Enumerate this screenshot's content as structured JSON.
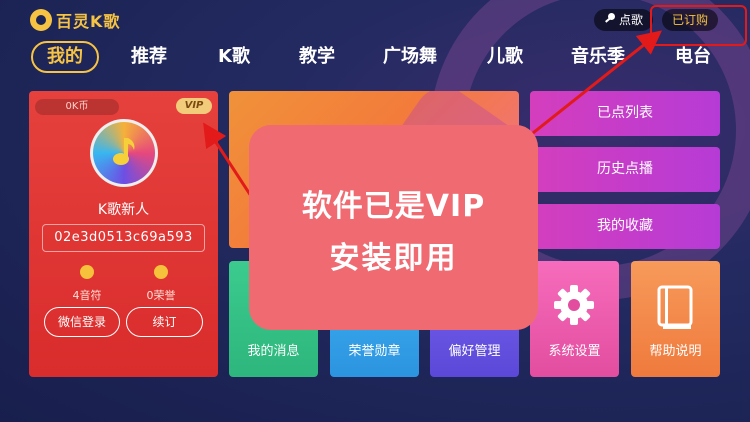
{
  "header": {
    "app_name": "百灵K歌",
    "song_button": "点歌",
    "purchased_button": "已订购"
  },
  "nav": {
    "tabs": [
      {
        "label": "我的",
        "active": true
      },
      {
        "label": "推荐"
      },
      {
        "label": "K歌"
      },
      {
        "label": "教学"
      },
      {
        "label": "广场舞"
      },
      {
        "label": "儿歌"
      },
      {
        "label": "音乐季"
      },
      {
        "label": "电台"
      }
    ]
  },
  "profile": {
    "coins": "0K币",
    "vip": "VIP",
    "nickname": "K歌新人",
    "user_id": "02e3d0513c69a593",
    "notes_label": "4音符",
    "honor_label": "0荣誉",
    "wechat_login": "微信登录",
    "renew": "续订"
  },
  "right_menu": {
    "ordered_list": "已点列表",
    "history": "历史点播",
    "favorites": "我的收藏"
  },
  "tiles": {
    "messages": "我的消息",
    "honor_medals": "荣誉勋章",
    "preferences": "偏好管理",
    "settings": "系统设置",
    "help": "帮助说明"
  },
  "overlay": {
    "line1": "软件已是VIP",
    "line2": "安装即用"
  },
  "colors": {
    "background": "#1b2456",
    "accent_gold": "#f6c343",
    "annotation_red": "#e21a1a",
    "profile_red": "#e6413d"
  }
}
